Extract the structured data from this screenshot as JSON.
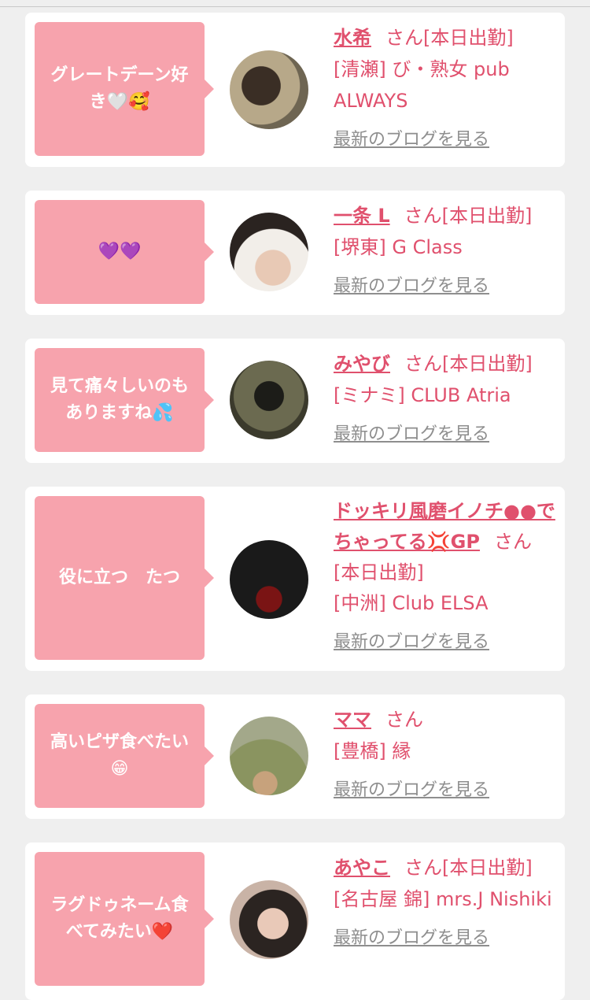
{
  "cards": [
    {
      "bubble": "グレートデーン好き🤍🥰",
      "name": "水希",
      "san": "さん",
      "status": "[本日出勤]",
      "area": "[清瀬]",
      "shop": "び・熟女 pub ALWAYS",
      "blog_link": "最新のブログを見る",
      "avatar_color": "#8a7a60"
    },
    {
      "bubble": "💜💜",
      "name": "一条 L",
      "san": "さん",
      "status": "[本日出勤]",
      "area": "[堺東]",
      "shop": "G Class",
      "blog_link": "最新のブログを見る",
      "avatar_color": "#d9d4cf"
    },
    {
      "bubble": "見て痛々しいのもありますね💦",
      "name": "みやび",
      "san": "さん",
      "status": "[本日出勤]",
      "area": "[ミナミ]",
      "shop": "CLUB Atria",
      "blog_link": "最新のブログを見る",
      "avatar_color": "#4a4a3a"
    },
    {
      "bubble": "役に立つ　たつ",
      "name": "ドッキリ風磨イノチ●●でちゃってる💢GP",
      "san": "さん",
      "status": "[本日出勤]",
      "area": "[中洲]",
      "shop": "Club ELSA",
      "blog_link": "最新のブログを見る",
      "avatar_color": "#141414"
    },
    {
      "bubble": "高いピザ食べたい😁",
      "name": "ママ",
      "san": "さん",
      "status": "",
      "area": "[豊橋]",
      "shop": "縁",
      "blog_link": "最新のブログを見る",
      "avatar_color": "#7f8a55"
    },
    {
      "bubble": "ラグドゥネーム食べてみたい❤️",
      "name": "あやこ",
      "san": "さん",
      "status": "[本日出勤]",
      "area": "[名古屋 錦]",
      "shop": "mrs.J Nishiki",
      "blog_link": "最新のブログを見る",
      "avatar_color": "#b9a59a"
    }
  ]
}
